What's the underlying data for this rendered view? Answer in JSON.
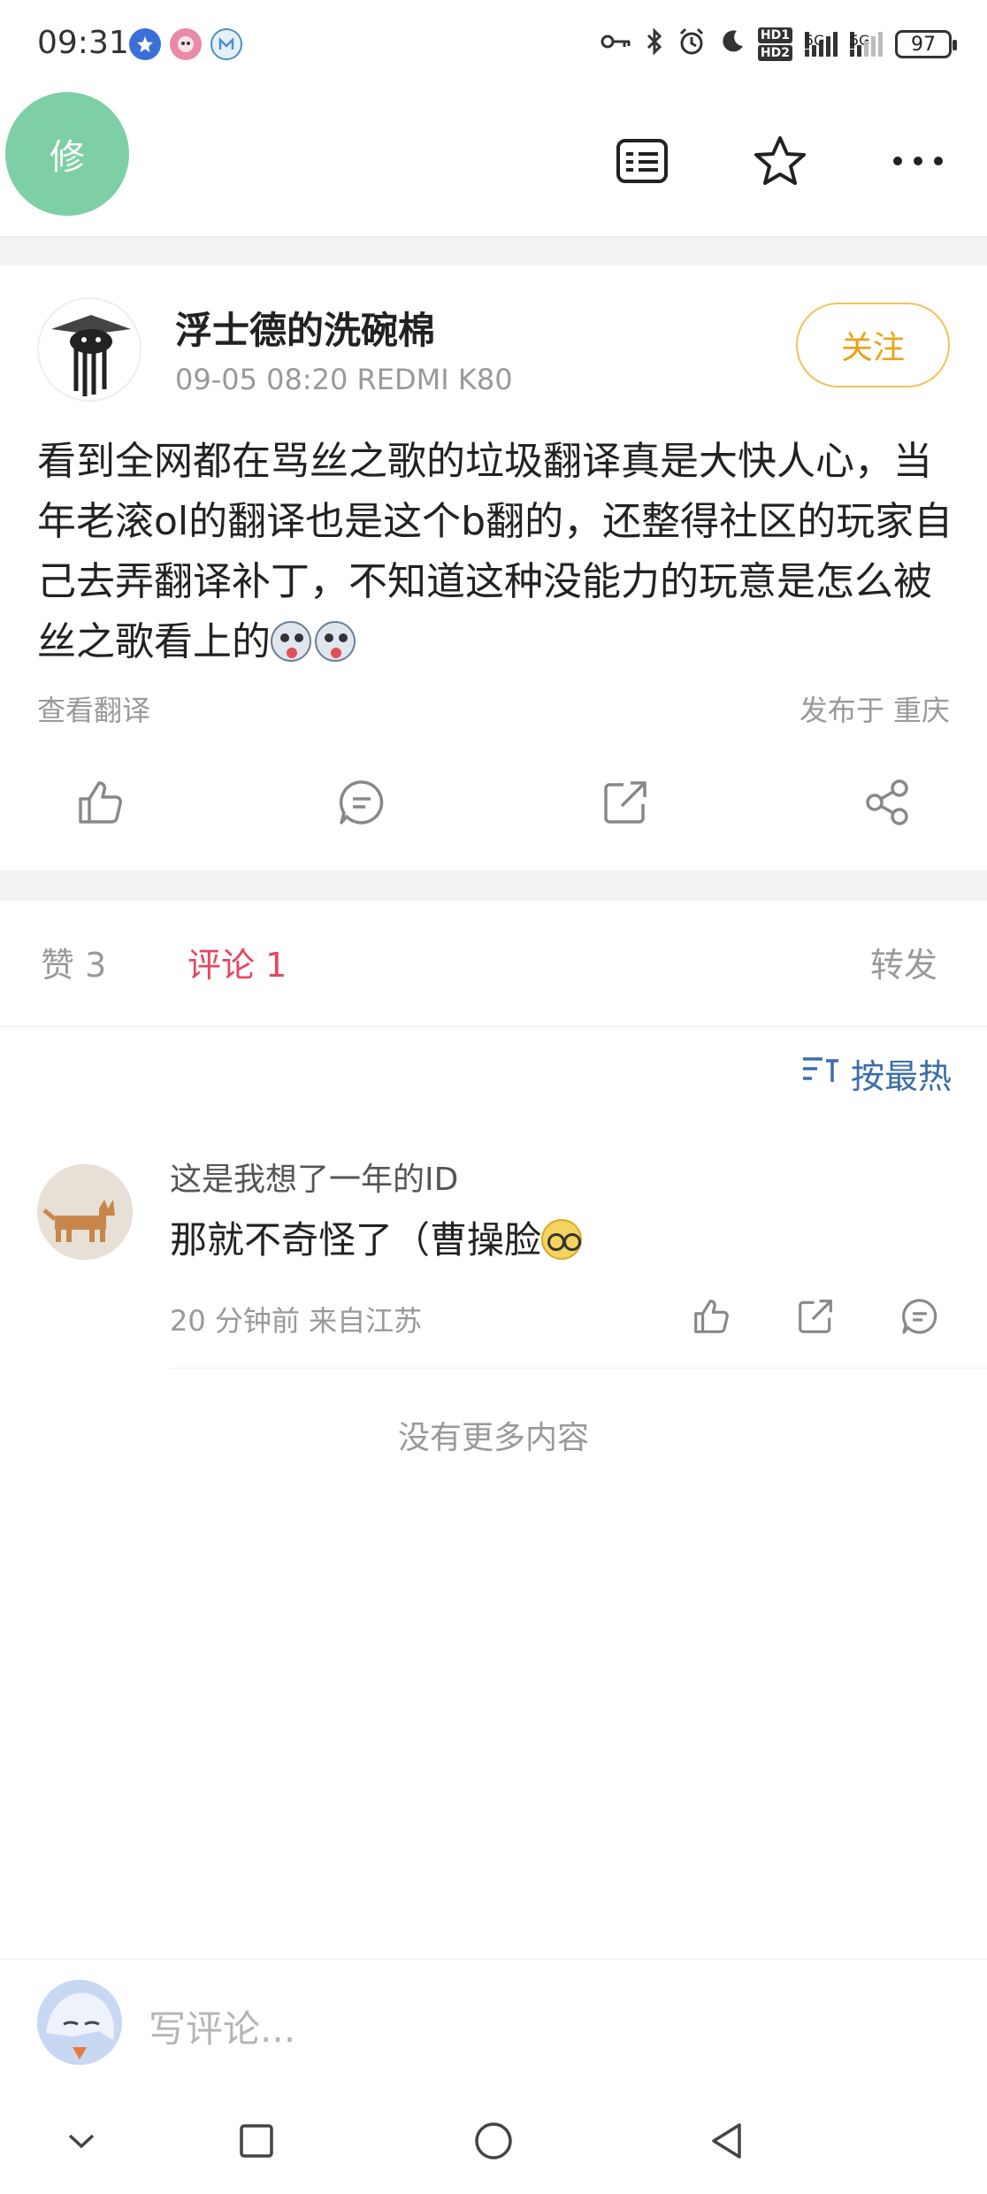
{
  "status_bar": {
    "time": "09:31",
    "battery": "97",
    "network_labels": [
      "5G",
      "5G"
    ],
    "hd_labels": [
      "HD1",
      "HD2"
    ],
    "icons": [
      "notification-app-icon-1",
      "notification-app-icon-2",
      "notification-app-icon-3",
      "key-icon",
      "bluetooth-icon",
      "alarm-icon",
      "moon-icon"
    ]
  },
  "top_bar": {
    "edit_badge": "修",
    "icons": [
      "translate-text-icon",
      "star-icon",
      "more-icon"
    ]
  },
  "post": {
    "author": "浮士德的洗碗棉",
    "meta": "09-05 08:20   REDMI K80",
    "follow_label": "关注",
    "body": "看到全网都在骂丝之歌的垃圾翻译真是大快人心，当年老滚ol的翻译也是这个b翻的，还整得社区的玩家自己去弄翻译补丁，不知道这种没能力的玩意是怎么被丝之歌看上的",
    "translate_label": "查看翻译",
    "location": "发布于 重庆",
    "actions": [
      "like-icon",
      "comment-icon",
      "repost-icon",
      "share-icon"
    ]
  },
  "tabs": {
    "like": "赞 3",
    "comment": "评论 1",
    "repost": "转发"
  },
  "sort": {
    "label": "按最热"
  },
  "comments": [
    {
      "user": "这是我想了一年的ID",
      "text": "那就不奇怪了（曹操脸",
      "meta": "20 分钟前  来自江苏"
    }
  ],
  "footer_note": "没有更多内容",
  "composer": {
    "placeholder": "写评论..."
  },
  "colors": {
    "accent_red": "#e5475e",
    "follow_orange": "#e8a317",
    "sort_blue": "#3b6ea8",
    "edit_badge_green": "#7ecfa6"
  }
}
